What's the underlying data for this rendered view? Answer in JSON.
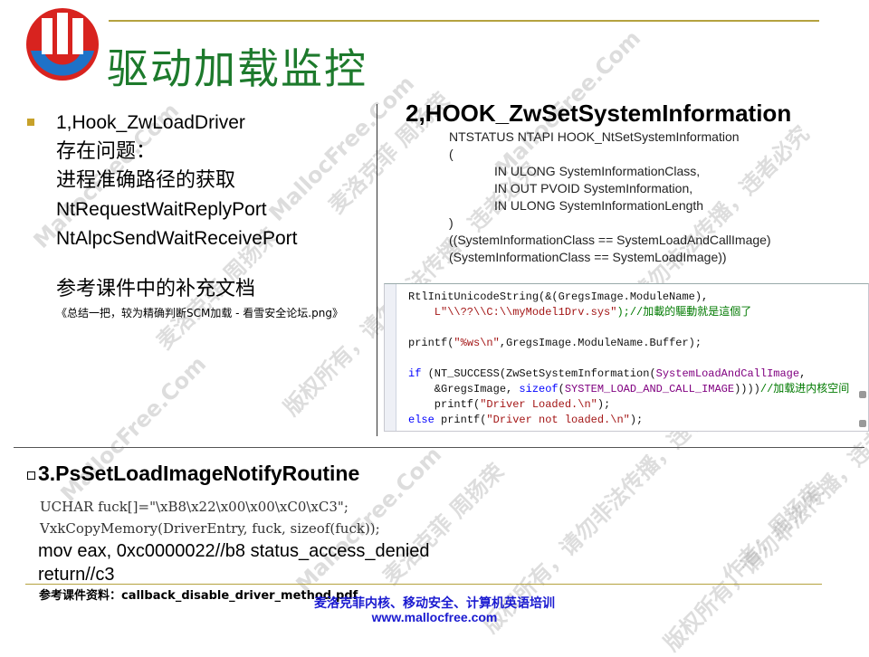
{
  "slide": {
    "title": "驱动加载监控",
    "logo_icon": "mallocfree-logo-icon",
    "colors": {
      "title": "#1d7a2c",
      "accent_rule": "#b5a23f",
      "footer": "#1a1ad0",
      "bullet": "#c7a12a"
    }
  },
  "left": {
    "lines": [
      "1,Hook_ZwLoadDriver",
      "存在问题：",
      "进程准确路径的获取",
      "NtRequestWaitReplyPort",
      "NtAlpcSendWaitReceivePort"
    ],
    "ref_heading": "参考课件中的补充文档",
    "ref_doc": "《总结一把，较为精确判断SCM加载 - 看雪安全论坛.png》"
  },
  "right": {
    "heading": "2,HOOK_ZwSetSystemInformation",
    "code": [
      "NTSTATUS NTAPI HOOK_NtSetSystemInformation",
      "(",
      "IN ULONG SystemInformationClass,",
      "IN OUT PVOID SystemInformation,",
      "IN ULONG SystemInformationLength",
      ")",
      "((SystemInformationClass == SystemLoadAndCallImage)",
      "(SystemInformationClass == SystemLoadImage))"
    ],
    "screenshot_code": {
      "l1": "RtlInitUnicodeString(&(GregsImage.ModuleName),",
      "l2a": "    L\"\\\\??\\\\C:\\\\myModel1Drv.sys\"",
      "l2b": ");//加載的驅動就是這個了",
      "l3a": "printf(",
      "l3b": "\"%ws\\n\"",
      "l3c": ",GregsImage.ModuleName.Buffer);",
      "l4a": "if",
      "l4b": " (NT_SUCCESS(ZwSetSystemInformation(",
      "l4c": "SystemLoadAndCallImage",
      "l4d": ",",
      "l5a": "    &GregsImage, ",
      "l5b": "sizeof",
      "l5c": "(",
      "l5d": "SYSTEM_LOAD_AND_CALL_IMAGE",
      "l5e": "))))",
      "l5f": "//加载进内核空间",
      "l6a": "    printf(",
      "l6b": "\"Driver Loaded.\\n\"",
      "l6c": ");",
      "l7a": "else",
      "l7b": " printf(",
      "l7c": "\"Driver not loaded.\\n\"",
      "l7d": ");"
    }
  },
  "section3": {
    "heading": "3.PsSetLoadImageNotifyRoutine",
    "img_code": [
      "UCHAR fuck[]=\"\\xB8\\x22\\x00\\x00\\xC0\\xC3\";",
      "VxkCopyMemory(DriverEntry, fuck, sizeof(fuck));"
    ],
    "asm": [
      "mov eax, 0xc0000022//b8 status_access_denied",
      "return//c3"
    ],
    "ref": "参考课件资料：callback_disable_driver_method.pdf"
  },
  "footer": {
    "line1": "麦洛克菲内核、移动安全、计算机英语培训",
    "line2": "www.mallocfree.com"
  },
  "watermarks": {
    "site": "MallocFree.Com",
    "author": "麦洛克菲 周扬荣",
    "copyright": "版权所有，请勿非法传播，违者必究",
    "author2": "作者：周扬荣"
  }
}
